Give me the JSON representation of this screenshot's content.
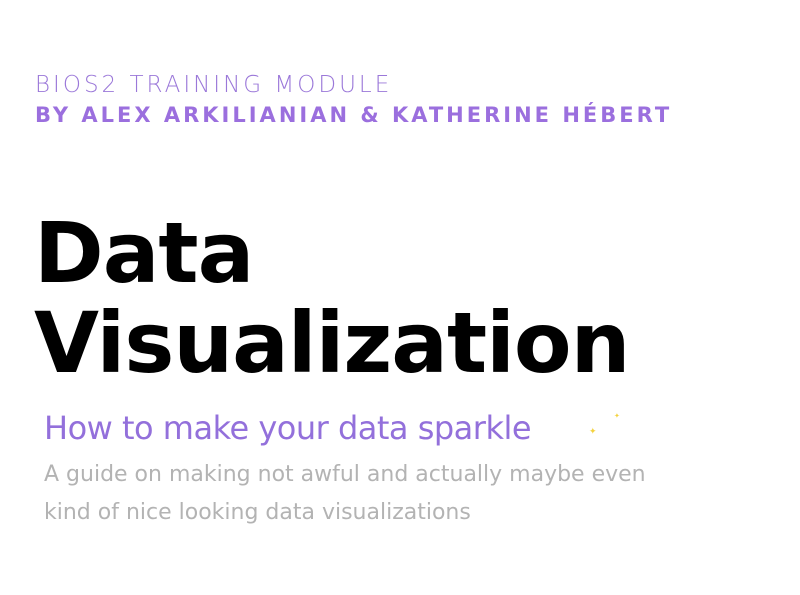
{
  "header": {
    "module": "BIOS2 TRAINING MODULE",
    "authors": "BY ALEX ARKILIANIAN & KATHERINE HÉBERT"
  },
  "title": {
    "line1": "Data",
    "line2": "Visualization"
  },
  "subtitle": "How to make your data sparkle",
  "description": {
    "line1": "A guide on making not awful and actually maybe even",
    "line2": "kind of nice looking data visualizations"
  },
  "icons": {
    "sparkle": "sparkle-icon"
  },
  "colors": {
    "accent": "#9370db",
    "title": "#000000",
    "body": "#b3b3b3",
    "sparkle": "#f4d23e"
  }
}
